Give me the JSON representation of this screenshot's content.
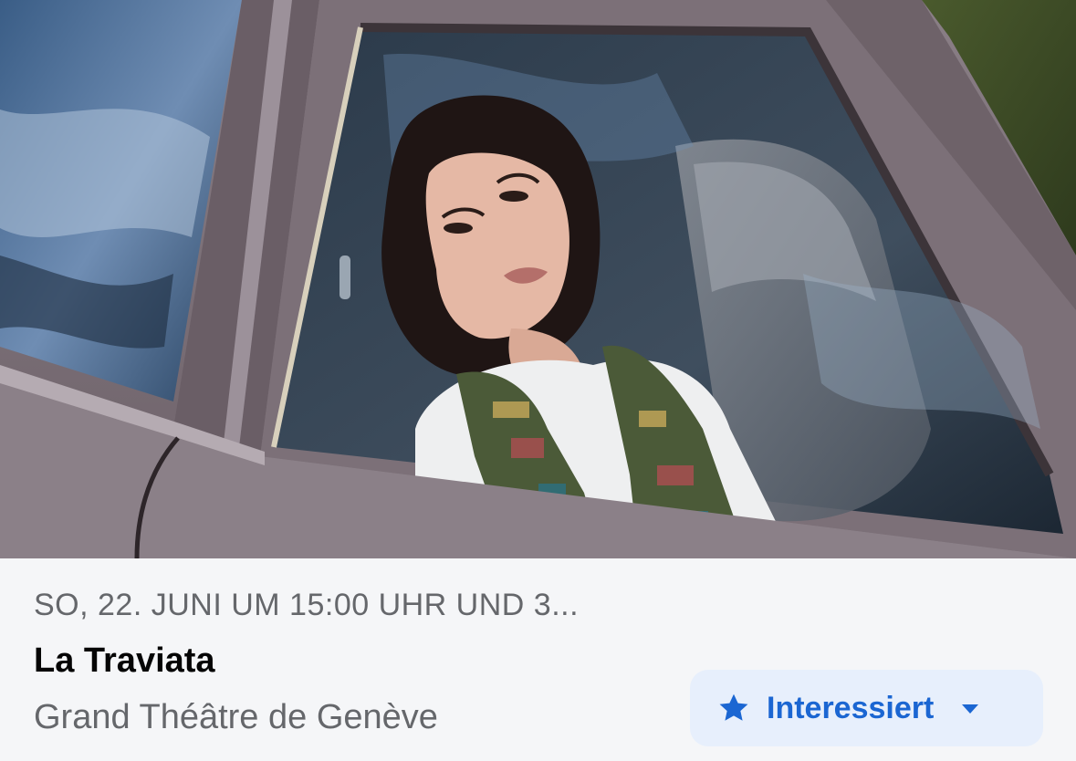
{
  "hero": {
    "image": "woman-in-car-window-photo"
  },
  "event": {
    "date": "SO, 22. JUNI UM 15:00 UHR UND 3...",
    "title": "La Traviata",
    "venue": "Grand Théâtre de Genève"
  },
  "interest_button": {
    "label": "Interessiert",
    "icon": "star-icon",
    "dropdown_icon": "caret-down-icon",
    "color": "#1b66d2",
    "background": "#e7effc"
  }
}
